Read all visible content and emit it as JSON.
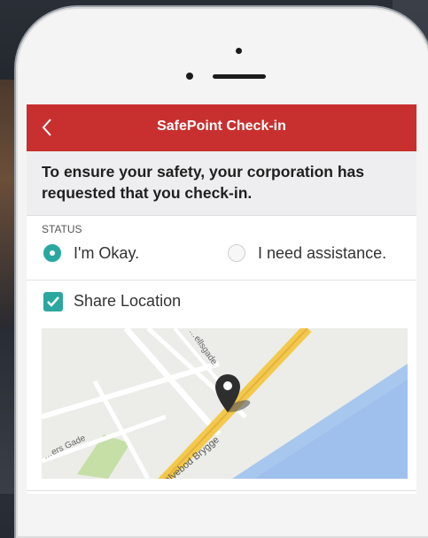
{
  "header": {
    "title": "SafePoint Check-in"
  },
  "notice": {
    "text": "To ensure your safety, your corporation has requested that you check-in."
  },
  "status": {
    "label": "STATUS",
    "options": [
      {
        "label": "I'm Okay.",
        "selected": true
      },
      {
        "label": "I need assistance.",
        "selected": false
      }
    ]
  },
  "share_location": {
    "label": "Share Location",
    "checked": true
  },
  "map": {
    "streets": [
      "Kalvebod Brygge",
      "…ellsgade",
      "…ers Gade"
    ]
  },
  "colors": {
    "accent": "#c8302f",
    "teal": "#2aa8a0"
  }
}
